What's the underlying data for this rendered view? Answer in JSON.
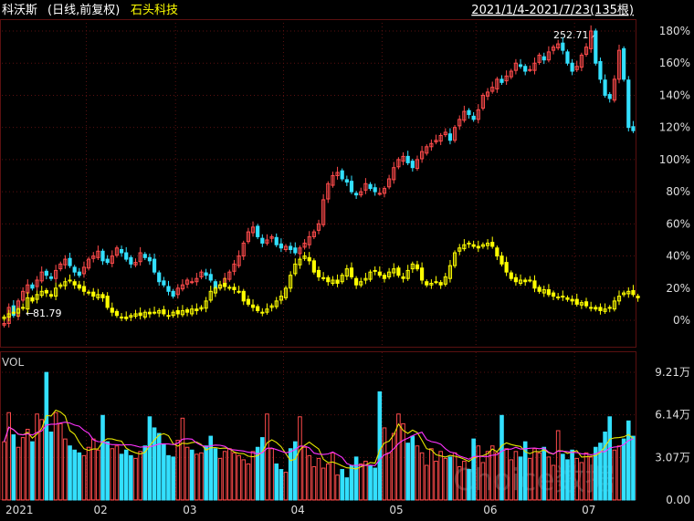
{
  "header": {
    "stock_name": "科沃斯",
    "mode": "(日线,前复权)",
    "compare_name": "石头科技",
    "date_range": "2021/1/4-2021/7/23(135根)"
  },
  "annotations": {
    "high_label": "252.71",
    "low_label": "81.79"
  },
  "volume_panel": {
    "label": "VOL",
    "y_ticks": [
      "9.21万",
      "6.14万",
      "3.07万",
      "0.00"
    ],
    "watermark": "Choice数据"
  },
  "colors": {
    "background": "#000000",
    "grid": "#5a1010",
    "up": "#ff4b4b",
    "down": "#33e0ff",
    "compare": "#ffff00",
    "ma5": "#e6e600",
    "ma10": "#ff33ff",
    "axis_text": "#dddddd"
  },
  "chart_data": {
    "type": "line",
    "x_ticks": [
      "2021",
      "02",
      "03",
      "04",
      "05",
      "06",
      "07"
    ],
    "y_ticks": [
      "180%",
      "160%",
      "140%",
      "120%",
      "100%",
      "80%",
      "60%",
      "40%",
      "20%",
      "0%"
    ],
    "ylim": [
      -5,
      190
    ],
    "y_unit": "%",
    "series": [
      {
        "name": "科沃斯",
        "style": "candlestick",
        "values": [
          -2,
          8,
          3,
          12,
          18,
          22,
          20,
          25,
          30,
          28,
          26,
          31,
          35,
          38,
          34,
          30,
          28,
          33,
          38,
          40,
          43,
          37,
          36,
          40,
          45,
          42,
          38,
          35,
          36,
          42,
          39,
          37,
          30,
          24,
          22,
          18,
          15,
          20,
          22,
          25,
          24,
          26,
          30,
          28,
          25,
          20,
          22,
          26,
          30,
          35,
          40,
          48,
          55,
          58,
          52,
          48,
          50,
          52,
          47,
          45,
          46,
          44,
          42,
          45,
          48,
          52,
          55,
          60,
          75,
          85,
          90,
          92,
          88,
          86,
          80,
          78,
          80,
          85,
          82,
          80,
          79,
          82,
          88,
          95,
          100,
          102,
          98,
          95,
          100,
          105,
          108,
          110,
          112,
          115,
          117,
          112,
          120,
          125,
          130,
          128,
          125,
          131,
          140,
          142,
          145,
          150,
          148,
          152,
          155,
          160,
          158,
          155,
          156,
          160,
          165,
          162,
          167,
          170,
          172,
          168,
          160,
          155,
          158,
          165,
          170,
          180,
          160,
          150,
          140,
          138,
          150,
          168,
          150,
          120,
          118
        ]
      },
      {
        "name": "石头科技",
        "style": "candlestick",
        "values": [
          2,
          4,
          5,
          7,
          8,
          14,
          12,
          16,
          18,
          17,
          15,
          20,
          22,
          24,
          25,
          22,
          20,
          18,
          17,
          15,
          16,
          14,
          8,
          5,
          3,
          2,
          1,
          3,
          4,
          3,
          5,
          4,
          5,
          6,
          4,
          3,
          5,
          4,
          6,
          5,
          7,
          6,
          8,
          12,
          18,
          20,
          22,
          21,
          20,
          19,
          18,
          12,
          10,
          8,
          6,
          5,
          7,
          9,
          12,
          15,
          20,
          28,
          35,
          38,
          40,
          37,
          30,
          27,
          26,
          24,
          25,
          23,
          28,
          32,
          27,
          22,
          24,
          26,
          30,
          31,
          28,
          26,
          30,
          32,
          28,
          26,
          31,
          35,
          32,
          25,
          22,
          23,
          24,
          22,
          27,
          34,
          42,
          45,
          47,
          48,
          46,
          45,
          47,
          48,
          46,
          40,
          35,
          30,
          26,
          24,
          25,
          24,
          25,
          20,
          18,
          19,
          16,
          15,
          14,
          15,
          13,
          12,
          10,
          11,
          9,
          8,
          7,
          6,
          7,
          8,
          12,
          15,
          17,
          18,
          16,
          14
        ]
      }
    ],
    "volume": {
      "unit": "万",
      "ylim": [
        0,
        9.21
      ],
      "values": [
        4.2,
        6.3,
        4.7,
        3.8,
        4.5,
        5.1,
        4.2,
        6.2,
        5.8,
        9.2,
        4.9,
        6.3,
        5.5,
        4.4,
        3.9,
        3.6,
        3.4,
        3.2,
        3.8,
        4.4,
        3.6,
        6.1,
        4.2,
        3.7,
        3.9,
        3.3,
        3.6,
        3.2,
        3.0,
        3.5,
        3.9,
        6.0,
        5.2,
        4.8,
        4.0,
        3.2,
        3.1,
        4.3,
        5.9,
        3.8,
        3.6,
        3.3,
        3.4,
        3.9,
        4.6,
        3.7,
        3.0,
        3.5,
        3.7,
        3.4,
        3.2,
        2.9,
        2.6,
        3.5,
        3.8,
        4.5,
        6.2,
        3.7,
        2.6,
        2.2,
        2.0,
        3.7,
        4.2,
        6.0,
        3.8,
        3.2,
        2.4,
        3.0,
        2.3,
        2.6,
        3.4,
        1.8,
        2.2,
        1.6,
        2.5,
        3.1,
        2.6,
        2.8,
        2.5,
        2.3,
        7.8,
        5.2,
        3.4,
        4.8,
        6.2,
        5.5,
        4.1,
        4.6,
        3.9,
        3.4,
        2.5,
        3.7,
        2.8,
        3.5,
        3.0,
        3.1,
        3.4,
        2.4,
        2.8,
        2.2,
        4.4,
        3.9,
        2.7,
        3.5,
        3.9,
        3.4,
        6.1,
        3.7,
        2.9,
        3.5,
        3.1,
        4.2,
        3.0,
        3.7,
        3.4,
        3.8,
        3.1,
        2.5,
        5.0,
        3.3,
        2.9,
        3.6,
        3.0,
        2.7,
        3.4,
        3.1,
        3.8,
        4.1,
        4.9,
        6.0,
        3.6,
        3.9,
        4.4,
        5.7,
        4.6
      ]
    }
  }
}
